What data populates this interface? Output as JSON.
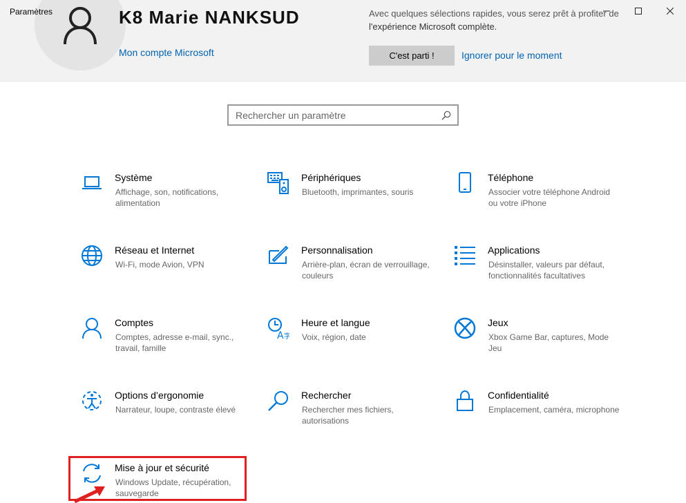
{
  "window": {
    "title": "Paramètres",
    "minimize_symbol": "—",
    "maximize_symbol": "☐",
    "close_symbol": "✕"
  },
  "account": {
    "name": "K8 Marie NANKSUD",
    "link": "Mon compte Microsoft"
  },
  "promo": {
    "line1": "Avec quelques sélections rapides, vous serez prêt à profiter de",
    "line2": "l'expérience Microsoft complète.",
    "primary_button": "C'est parti !",
    "secondary_link": "Ignorer pour le moment"
  },
  "search": {
    "placeholder": "Rechercher un paramètre",
    "value": ""
  },
  "colors": {
    "accent": "#0063b1",
    "icon": "#0078d7",
    "highlight": "#e02020"
  },
  "tiles": [
    {
      "icon": "laptop-icon",
      "title": "Système",
      "desc": "Affichage, son, notifications, alimentation"
    },
    {
      "icon": "keyboard-icon",
      "title": "Périphériques",
      "desc": "Bluetooth, imprimantes, souris"
    },
    {
      "icon": "phone-icon",
      "title": "Téléphone",
      "desc": "Associer votre téléphone Android ou votre iPhone"
    },
    {
      "icon": "globe-icon",
      "title": "Réseau et Internet",
      "desc": "Wi-Fi, mode Avion, VPN"
    },
    {
      "icon": "paint-icon",
      "title": "Personnalisation",
      "desc": "Arrière-plan, écran de verrouillage, couleurs"
    },
    {
      "icon": "apps-list-icon",
      "title": "Applications",
      "desc": "Désinstaller, valeurs par défaut, fonctionnalités facultatives"
    },
    {
      "icon": "person-icon",
      "title": "Comptes",
      "desc": "Comptes, adresse e-mail, sync., travail, famille"
    },
    {
      "icon": "time-language-icon",
      "title": "Heure et langue",
      "desc": "Voix, région, date"
    },
    {
      "icon": "xbox-icon",
      "title": "Jeux",
      "desc": "Xbox Game Bar, captures, Mode Jeu"
    },
    {
      "icon": "ease-of-access-icon",
      "title": "Options d’ergonomie",
      "desc": "Narrateur, loupe, contraste élevé"
    },
    {
      "icon": "search-magnifier-icon",
      "title": "Rechercher",
      "desc": "Rechercher mes fichiers, autorisations"
    },
    {
      "icon": "lock-icon",
      "title": "Confidentialité",
      "desc": "Emplacement, caméra, microphone"
    },
    {
      "icon": "update-sync-icon",
      "title": "Mise à jour et sécurité",
      "desc": "Windows Update, récupération, sauvegarde"
    }
  ]
}
